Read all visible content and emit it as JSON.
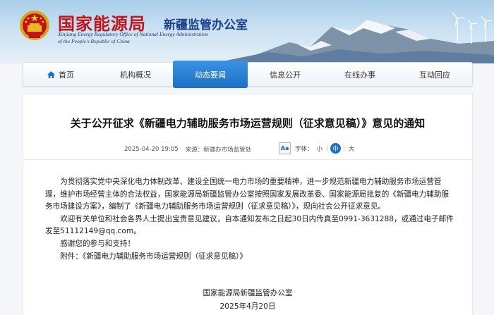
{
  "header": {
    "title": "国家能源局",
    "subtitle": "新疆监管办公室",
    "english_lines": [
      "Xinjiang Energy Regulatory Office of National Energy Administration",
      "of the People's Republic of China"
    ],
    "emblem_icon": "national-emblem-icon"
  },
  "nav": {
    "items": [
      {
        "label": "首页",
        "icon": "home-icon",
        "active": false
      },
      {
        "label": "机构概况",
        "active": false
      },
      {
        "label": "动态要闻",
        "active": true
      },
      {
        "label": "信息公开",
        "active": false
      },
      {
        "label": "在线办事",
        "active": false
      },
      {
        "label": "互动回应",
        "active": false
      }
    ]
  },
  "article": {
    "title": "关于公开征求《新疆电力辅助服务市场运营规则（征求意见稿）》意见的通知",
    "date": "2025-04-20 19:05",
    "source": "来源：新疆办市场监管处",
    "font_icon_text": "Aa",
    "font_label": "字体：",
    "font_sizes": {
      "small": "小",
      "medium": "中",
      "large": "大",
      "separator": "|"
    },
    "paragraphs": [
      "为贯彻落实党中央深化电力体制改革、建设全国统一电力市场的重要精神，进一步规范新疆电力辅助服务市场运营管理，维护市场经营主体的合法权益，国家能源局新疆监管办公室按照国家发展改革委、国家能源局批复的《新疆电力辅助服务市场建设方案》，编制了《新疆电力辅助服务市场运营规则（征求意见稿）》，现向社会公开征求意见。",
      "欢迎有关单位和社会各界人士提出宝贵意见建议，自本通知发布之日起30日内传真至0991-3631288，或通过电子邮件发至51112149@qq.com。",
      "感谢您的参与和支持！",
      "附件：《新疆电力辅助服务市场运营规则（征求意见稿）》"
    ],
    "signature": "国家能源局新疆监管办公室",
    "sign_date": "2025年4月20日"
  },
  "colors": {
    "title_red": "#c0141b",
    "subtitle_blue": "#1d3f88",
    "nav_active": "#1d6fc4"
  }
}
